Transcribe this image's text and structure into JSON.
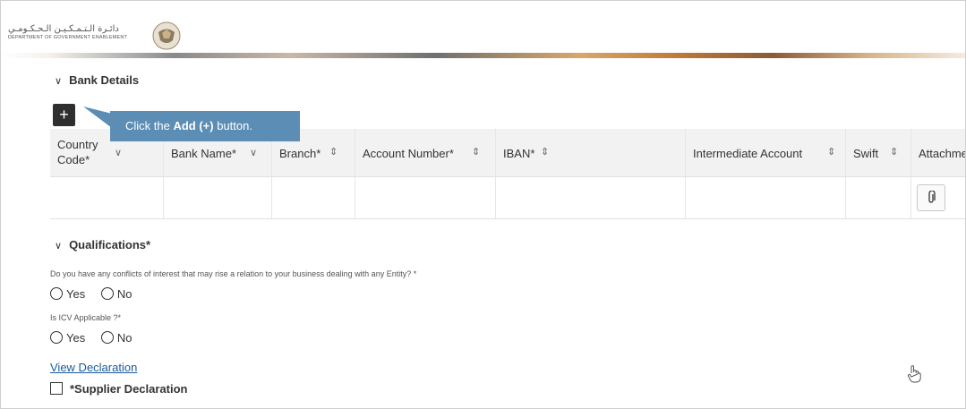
{
  "header": {
    "logo_arabic": "دائـرة الـتـمـكـيـن الـحـكـومـي",
    "logo_english": "DEPARTMENT OF GOVERNMENT ENABLEMENT"
  },
  "bank_details": {
    "title": "Bank Details",
    "add_button_label": "+",
    "callout": {
      "prefix": "Click the ",
      "bold": "Add (+)",
      "suffix": " button."
    },
    "columns": [
      {
        "label": "Country Code*",
        "label_line1": "Country",
        "label_line2": "Code*",
        "sort_icon": "chevron-down"
      },
      {
        "label": "Bank Name*",
        "sort_icon": "chevron-down"
      },
      {
        "label": "Branch*",
        "sort_icon": "sort-updown"
      },
      {
        "label": "Account Number*",
        "sort_icon": "sort-updown"
      },
      {
        "label": "IBAN*",
        "sort_icon": "sort-updown"
      },
      {
        "label": "Intermediate Account",
        "sort_icon": "sort-updown"
      },
      {
        "label": "Swift",
        "sort_icon": "sort-updown"
      },
      {
        "label": "Attachme"
      }
    ],
    "attachment_icon": "paperclip-icon"
  },
  "qualifications": {
    "title": "Qualifications*",
    "q1": "Do you have any conflicts of interest that may rise a relation to your business dealing with any Entity? *",
    "q2": "Is ICV Applicable ?*",
    "yes": "Yes",
    "no": "No",
    "view_declaration": "View Declaration",
    "supplier_declaration": "*Supplier Declaration"
  },
  "colors": {
    "callout": "#5b8db5",
    "link": "#1a5b9e",
    "add_button": "#2f2f2f"
  }
}
